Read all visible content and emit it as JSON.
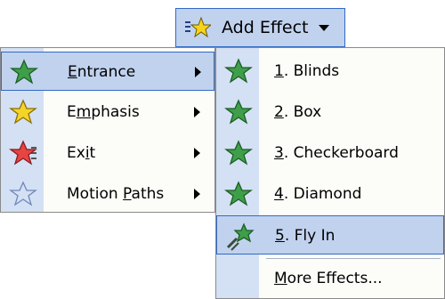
{
  "add_effect": {
    "label": "Add Effect",
    "icon": "add-effect-star-icon"
  },
  "main_menu": {
    "items": [
      {
        "label": "Entrance",
        "mnemonic_index": 0,
        "icon": "green-star-icon",
        "has_submenu": true,
        "highlighted": true,
        "color": "#2e8b3a"
      },
      {
        "label": "Emphasis",
        "mnemonic_index": 1,
        "icon": "yellow-star-icon",
        "has_submenu": true,
        "highlighted": false,
        "color": "#f2cf1f"
      },
      {
        "label": "Exit",
        "mnemonic_index": 2,
        "icon": "red-star-icon",
        "has_submenu": true,
        "highlighted": false,
        "color": "#e23b3b"
      },
      {
        "label": "Motion Paths",
        "mnemonic_index": 7,
        "icon": "outline-star-icon",
        "has_submenu": true,
        "highlighted": false,
        "color": "#7d98c8"
      }
    ]
  },
  "entrance_submenu": {
    "items": [
      {
        "number": "1",
        "label": ". Blinds",
        "icon": "green-star-icon",
        "highlighted": false
      },
      {
        "number": "2",
        "label": ". Box",
        "icon": "green-star-icon",
        "highlighted": false
      },
      {
        "number": "3",
        "label": ". Checkerboard",
        "icon": "green-star-icon",
        "highlighted": false
      },
      {
        "number": "4",
        "label": ". Diamond",
        "icon": "green-star-icon",
        "highlighted": false
      },
      {
        "number": "5",
        "label": ". Fly In",
        "icon": "fly-in-star-icon",
        "highlighted": true
      }
    ],
    "more": {
      "mnemonic": "M",
      "rest": "ore Effects..."
    }
  }
}
